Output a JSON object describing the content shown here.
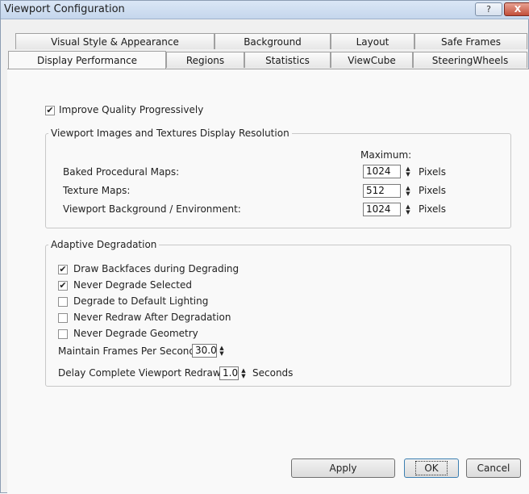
{
  "window": {
    "title": "Viewport Configuration",
    "help_label": "?",
    "close_label": "X"
  },
  "tabs_row1": [
    "Visual Style & Appearance",
    "Background",
    "Layout",
    "Safe Frames"
  ],
  "tabs_row2": [
    "Display Performance",
    "Regions",
    "Statistics",
    "ViewCube",
    "SteeringWheels"
  ],
  "active_tab": "Display Performance",
  "improve_quality": {
    "label": "Improve Quality Progressively",
    "checked": true
  },
  "resolution_group": {
    "title": "Viewport Images and Textures Display Resolution",
    "maximum_label": "Maximum:",
    "unit": "Pixels",
    "rows": [
      {
        "label": "Baked Procedural Maps:",
        "value": "1024"
      },
      {
        "label": "Texture Maps:",
        "value": "512"
      },
      {
        "label": "Viewport Background / Environment:",
        "value": "1024"
      }
    ]
  },
  "adaptive_group": {
    "title": "Adaptive Degradation",
    "options": [
      {
        "label": "Draw Backfaces during Degrading",
        "checked": true
      },
      {
        "label": "Never Degrade Selected",
        "checked": true
      },
      {
        "label": "Degrade to Default Lighting",
        "checked": false
      },
      {
        "label": "Never Redraw After Degradation",
        "checked": false
      },
      {
        "label": "Never Degrade Geometry",
        "checked": false
      }
    ],
    "fps_label": "Maintain Frames Per Second:",
    "fps_value": "30.0",
    "delay_label": "Delay Complete Viewport Redraw in",
    "delay_value": "1.0",
    "delay_unit": "Seconds"
  },
  "buttons": {
    "apply": "Apply",
    "ok": "OK",
    "cancel": "Cancel"
  },
  "icons": {
    "check": "✔",
    "spin_up": "▲",
    "spin_down": "▼"
  }
}
